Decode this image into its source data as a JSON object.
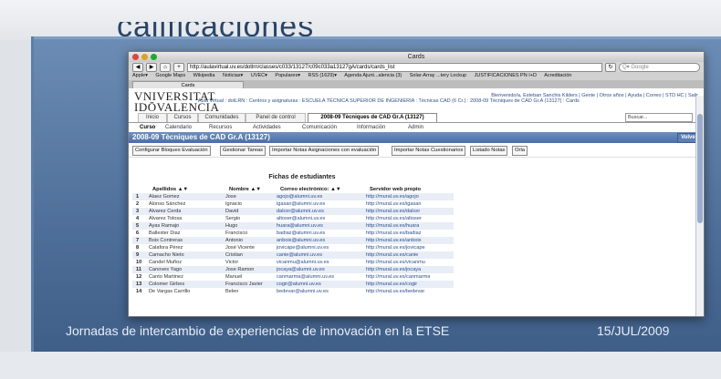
{
  "slide": {
    "title": "calificaciones",
    "footer_text": "Jornadas de intercambio de experiencias de innovación en la ETSE",
    "footer_date": "15/JUL/2009"
  },
  "browser": {
    "window_title": "Cards",
    "url": "http://aulavirtual.uv.es/dotlrn/classes/c033/13127/c09c033a13127gA/cards/cards_list",
    "search_placeholder": "Q▾ Google",
    "bookmarks": [
      "Apple▾",
      "Google Maps",
      "Wikipedia",
      "Noticias▾",
      "UVEC▾",
      "Populares▾",
      "RSS (1629)▾",
      "Agenda Ajunt...alencia (3)",
      "Solar-Array ...tery Lockup",
      "JUSTIFICACIONES PN I+D",
      "Acreditación"
    ],
    "page_tab": "Cards"
  },
  "header": {
    "logo_line1": "VNIVERSITAT",
    "logo_line2": "IDŌVALENCIA",
    "breadcrumb": "Aula Virtual : dotLRN : Centros y asignaturas : ESCUELA TÉCNICA SUPERIOR DE INGENIERÍA : Técnicas CAD (6 Cr.) : 2008-09 Técniques de CAD Gr.A (13127) : Cards",
    "user_links": "Bienvenido/a, Esteban Sanchis Kilders | Gente | Otros años | Ayuda | Correo | STD HC | Salir"
  },
  "nav": {
    "tabs": [
      "Inicio",
      "Cursos",
      "Comunidades",
      "Panel de control",
      "2008-09 Tècniques de CAD Gr.A (13127)"
    ],
    "search_value": "Buscar...",
    "subtabs": [
      "Curso",
      "Calendario",
      "Recursos",
      "Actividades",
      "Comunicación",
      "Información",
      "Admin"
    ]
  },
  "course": {
    "title": "2008-09 Tècniques de CAD Gr.A (13127)",
    "back_label": "Volver"
  },
  "actions": [
    "Configurar Bloques Evaluación",
    "Gestionar Tareas",
    "Importar Notas Asignaciones con evaluación",
    "Importar Notas Cuestionarios",
    "Listado Notas",
    "Orla"
  ],
  "table": {
    "title": "Fichas de estudiantes",
    "headers": [
      "Apellidos ▲▼",
      "Nombre ▲▼",
      "Correo electrónico: ▲▼",
      "Servidor web propio"
    ],
    "rows": [
      [
        "1",
        "Alaez Gomez",
        "Jose",
        "agojo@alumni.uv.es",
        "http://mural.uv.es/agojo"
      ],
      [
        "2",
        "Alonso Sánchez",
        "Ignacio",
        "igasan@alumni.uv.es",
        "http://mural.uv.es/igasan"
      ],
      [
        "3",
        "Alvarez Cerda",
        "David",
        "dalcer@alumni.uv.es",
        "http://mural.uv.es/dalcer"
      ],
      [
        "4",
        "Alvarez Tolosa",
        "Sergio",
        "altoser@alumni.uv.es",
        "http://mural.uv.es/altoser"
      ],
      [
        "5",
        "Ayas Ramajo",
        "Hugo",
        "huara@alumni.uv.es",
        "http://mural.uv.es/huara"
      ],
      [
        "6",
        "Ballester Diaz",
        "Francisco",
        "badiaz@alumni.uv.es",
        "http://mural.uv.es/badiaz"
      ],
      [
        "7",
        "Boix Contreras",
        "Antonio",
        "anboix@alumni.uv.es",
        "http://mural.uv.es/anboix"
      ],
      [
        "8",
        "Calafora Pérez",
        "José Vicente",
        "jovicape@alumni.uv.es",
        "http://mural.uv.es/jovicape"
      ],
      [
        "9",
        "Camacho Nieto",
        "Cristian",
        "canie@alumni.uv.es",
        "http://mural.uv.es/canie"
      ],
      [
        "10",
        "Candel Muñoz",
        "Victor",
        "vicanmu@alumni.uv.es",
        "http://mural.uv.es/vicanmu"
      ],
      [
        "11",
        "Canoves Yago",
        "Jose Ramon",
        "jocaya@alumni.uv.es",
        "http://mural.uv.es/jocaya"
      ],
      [
        "12",
        "Canto Martinez",
        "Manuel",
        "canmarma@alumni.uv.es",
        "http://mural.uv.es/canmarma"
      ],
      [
        "13",
        "Colomer Girbes",
        "Francisco Javier",
        "cogir@alumni.uv.es",
        "http://mural.uv.es/cogir"
      ],
      [
        "14",
        "De Vargas Carrillo",
        "Belen",
        "bedevar@alumni.uv.es",
        "http://mural.uv.es/bedevar"
      ]
    ]
  },
  "colors": {
    "accent": "#4a6ea8",
    "slide_bg": "#4e6f99"
  }
}
